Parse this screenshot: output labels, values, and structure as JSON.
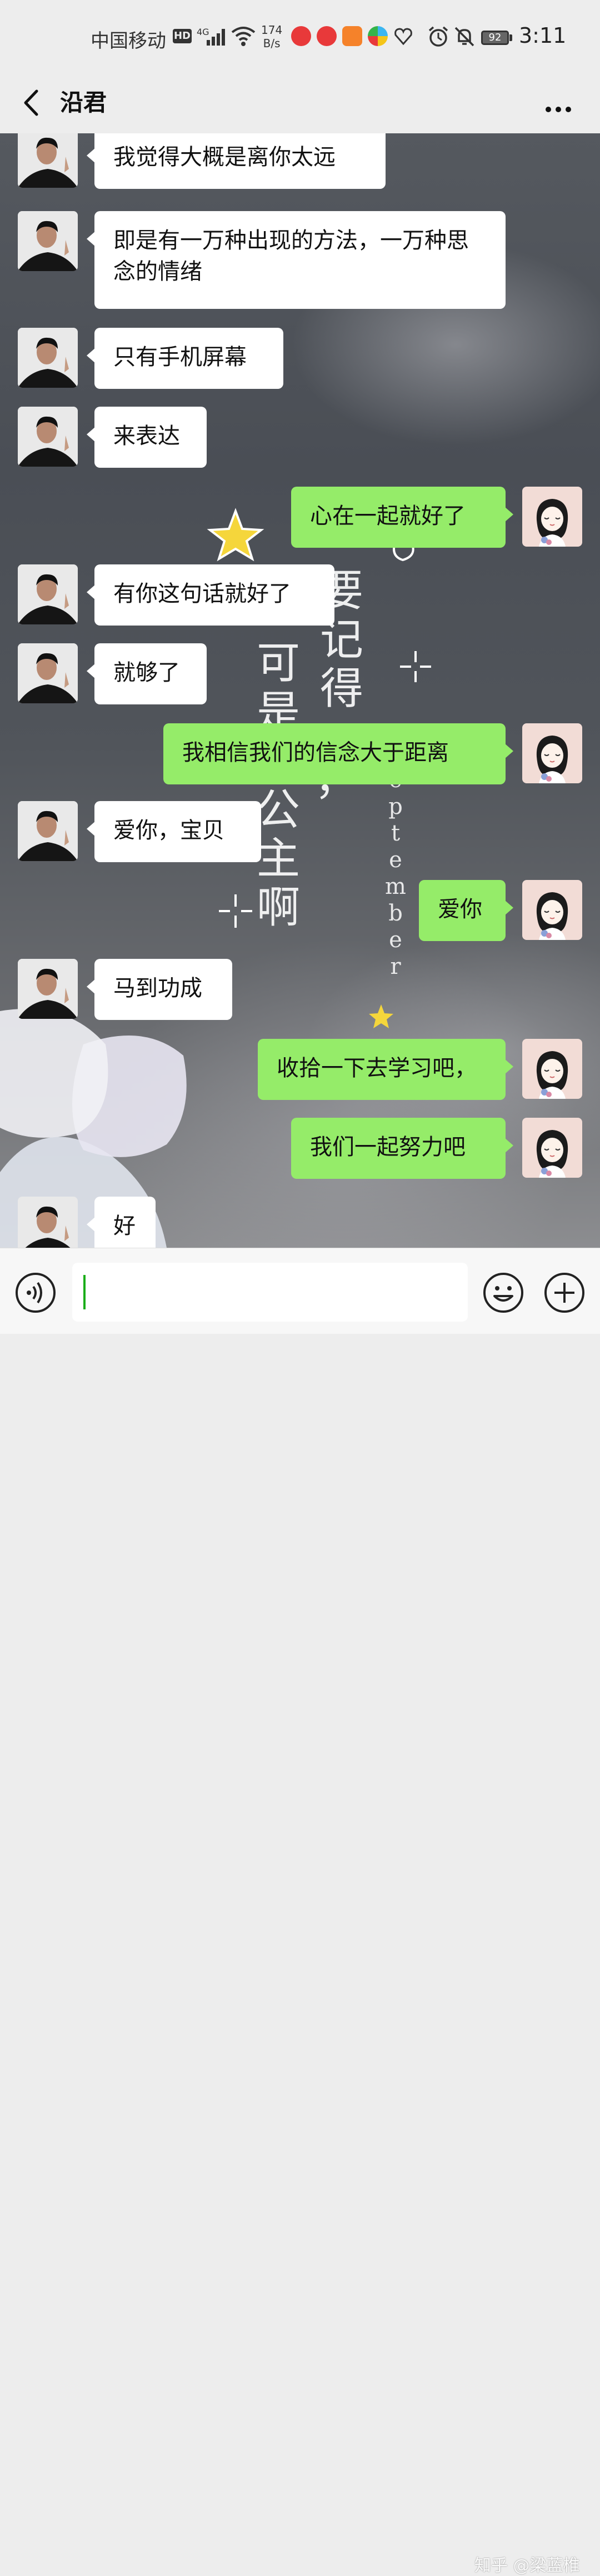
{
  "status_bar": {
    "carrier": "中国移动",
    "hd": "HD",
    "network": "4G",
    "speed_value": "174",
    "speed_unit": "B/s",
    "battery": "92",
    "time": "3:11"
  },
  "header": {
    "title": "沿君",
    "back_icon": "chevron-left-icon",
    "more_icon": "more-dots-icon"
  },
  "background_text": {
    "line_left": "可是不公主啊",
    "line_right_top": "要记得",
    "punct": "，",
    "english_vertical": "September"
  },
  "messages": [
    {
      "side": "in",
      "text": "我觉得大概是离你太远"
    },
    {
      "side": "in",
      "text": "即是有一万种出现的方法，一万种思念的情绪"
    },
    {
      "side": "in",
      "text": "只有手机屏幕"
    },
    {
      "side": "in",
      "text": "来表达"
    },
    {
      "side": "out",
      "text": "心在一起就好了"
    },
    {
      "side": "in",
      "text": "有你这句话就好了"
    },
    {
      "side": "in",
      "text": "就够了"
    },
    {
      "side": "out",
      "text": "我相信我们的信念大于距离"
    },
    {
      "side": "in",
      "text": "爱你，宝贝"
    },
    {
      "side": "out",
      "text": "爱你"
    },
    {
      "side": "in",
      "text": "马到功成"
    },
    {
      "side": "out",
      "text": "收拾一下去学习吧，"
    },
    {
      "side": "out",
      "text": "我们一起努力吧"
    },
    {
      "side": "in",
      "text": "好"
    }
  ],
  "input_bar": {
    "value": "",
    "voice_icon": "voice-icon",
    "emoji_icon": "emoji-icon",
    "plus_icon": "plus-icon"
  },
  "watermark": "知乎 @梁蓝椎",
  "colors": {
    "outgoing_bubble": "#95ec69",
    "incoming_bubble": "#ffffff",
    "header_bg": "#ededed"
  }
}
